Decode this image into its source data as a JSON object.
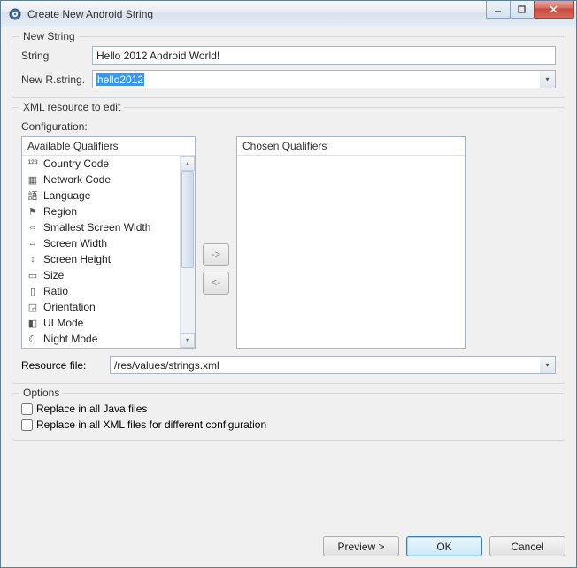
{
  "window": {
    "title": "Create New Android String"
  },
  "new_string": {
    "legend": "New String",
    "string_label": "String",
    "string_value": "Hello 2012 Android World!",
    "rstring_label": "New R.string.",
    "rstring_value": "hello2012"
  },
  "xml": {
    "legend": "XML resource to edit",
    "configuration_label": "Configuration:",
    "available_header": "Available Qualifiers",
    "chosen_header": "Chosen Qualifiers",
    "items": [
      {
        "icon": "123",
        "label": "Country Code"
      },
      {
        "icon": "grid",
        "label": "Network Code"
      },
      {
        "icon": "lang",
        "label": "Language"
      },
      {
        "icon": "flag",
        "label": "Region"
      },
      {
        "icon": "sw",
        "label": "Smallest Screen Width"
      },
      {
        "icon": "hw",
        "label": "Screen Width"
      },
      {
        "icon": "vh",
        "label": "Screen Height"
      },
      {
        "icon": "size",
        "label": "Size"
      },
      {
        "icon": "ratio",
        "label": "Ratio"
      },
      {
        "icon": "orient",
        "label": "Orientation"
      },
      {
        "icon": "ui",
        "label": "UI Mode"
      },
      {
        "icon": "night",
        "label": "Night Mode"
      }
    ],
    "move_right": "->",
    "move_left": "<-",
    "resource_label": "Resource file:",
    "resource_value": "/res/values/strings.xml"
  },
  "options": {
    "legend": "Options",
    "replace_java": "Replace in all Java files",
    "replace_xml": "Replace in all XML files for different configuration"
  },
  "buttons": {
    "preview": "Preview >",
    "ok": "OK",
    "cancel": "Cancel"
  },
  "icons": {
    "123": "¹²³",
    "grid": "▦",
    "lang": "語",
    "flag": "⚑",
    "sw": "⇔",
    "hw": "↔",
    "vh": "↕",
    "size": "▭",
    "ratio": "▯",
    "orient": "◲",
    "ui": "◧",
    "night": "☾"
  }
}
